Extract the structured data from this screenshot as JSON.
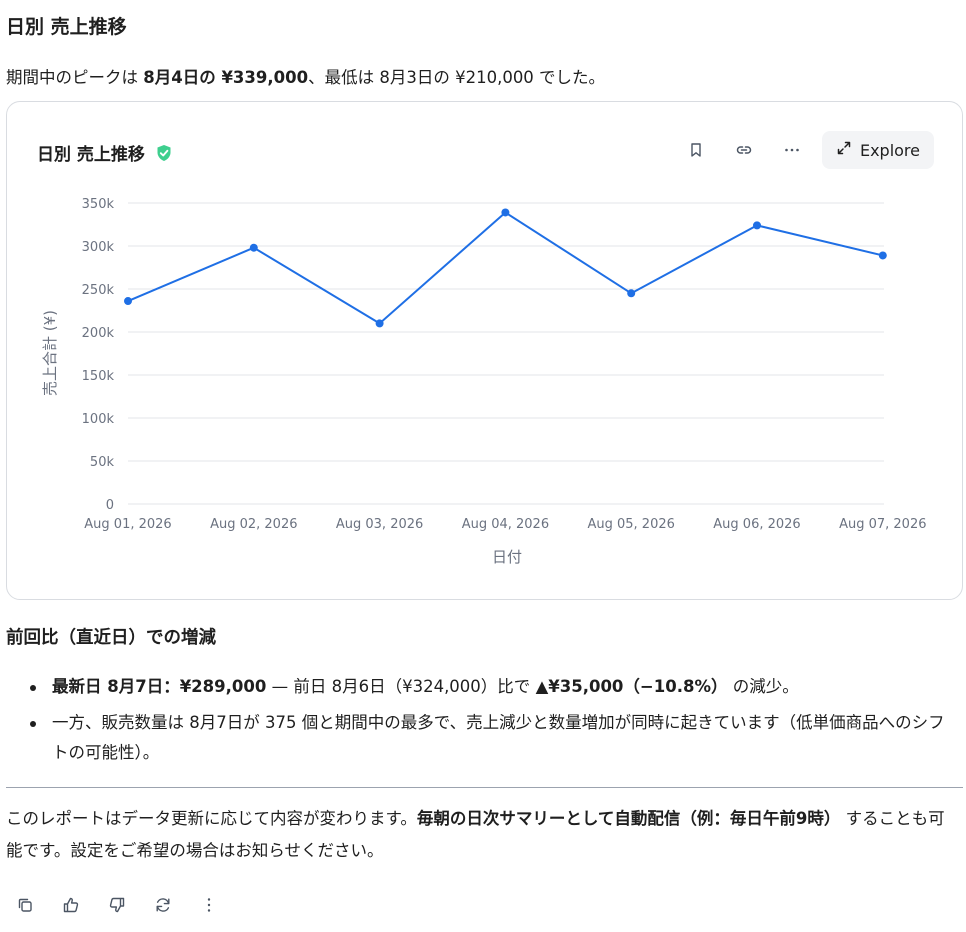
{
  "heading": "日別 売上推移",
  "intro": {
    "prefix": "期間中のピークは ",
    "peak": "8月4日の ¥339,000",
    "middle": "、最低は 8月3日の ¥210,000 でした。"
  },
  "card": {
    "title": "日別 売上推移",
    "verified_icon": "shield-check-icon",
    "tools": [
      "bookmark-icon",
      "link-icon",
      "more-horizontal-icon"
    ],
    "explore_label": "Explore"
  },
  "chart_data": {
    "type": "line",
    "categories": [
      "Aug 01, 2026",
      "Aug 02, 2026",
      "Aug 03, 2026",
      "Aug 04, 2026",
      "Aug 05, 2026",
      "Aug 06, 2026",
      "Aug 07, 2026"
    ],
    "series": [
      {
        "values": [
          236000,
          298000,
          210000,
          339000,
          245000,
          324000,
          289000
        ],
        "color": "#1f6fe5"
      }
    ],
    "xlabel": "日付",
    "ylabel": "売上合計 (¥)",
    "ylim": [
      0,
      350000
    ],
    "yticks": [
      0,
      50000,
      100000,
      150000,
      200000,
      250000,
      300000,
      350000
    ],
    "ytick_labels": [
      "0",
      "50k",
      "100k",
      "150k",
      "200k",
      "250k",
      "300k",
      "350k"
    ],
    "grid": true
  },
  "section2": {
    "heading": "前回比（直近日）での増減",
    "bullet1": {
      "bold1": "最新日 8月7日：¥289,000",
      "text1": " — 前日 8月6日（¥324,000）比で ",
      "bold2": "▲¥35,000（−10.8%）",
      "text2": " の減少。"
    },
    "bullet2": "一方、販売数量は 8月7日が 375 個と期間中の最多で、売上減少と数量増加が同時に起きています（低単価商品へのシフトの可能性）。"
  },
  "outro": {
    "text1": "このレポートはデータ更新に応じて内容が変わります。",
    "bold": "毎朝の日次サマリーとして自動配信（例：毎日午前9時）",
    "text2": " することも可能です。設定をご希望の場合はお知らせください。"
  },
  "actions": [
    "copy-icon",
    "thumbs-up-icon",
    "thumbs-down-icon",
    "refresh-icon",
    "more-vertical-icon"
  ]
}
